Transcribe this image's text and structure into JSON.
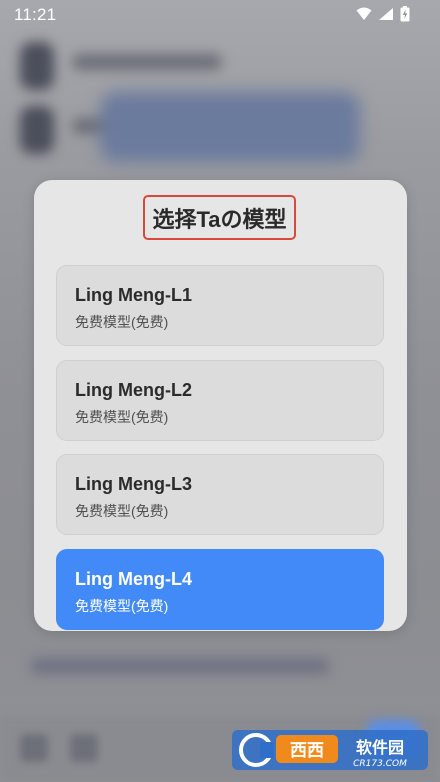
{
  "status_bar": {
    "time": "11:21",
    "icons": [
      "wifi-icon",
      "signal-icon",
      "battery-icon"
    ]
  },
  "dialog": {
    "title": "选择Taの模型",
    "models": [
      {
        "name": "Ling Meng-L1",
        "desc": "免费模型(免费)",
        "selected": false
      },
      {
        "name": "Ling Meng-L2",
        "desc": "免费模型(免费)",
        "selected": false
      },
      {
        "name": "Ling Meng-L3",
        "desc": "免费模型(免费)",
        "selected": false
      },
      {
        "name": "Ling Meng-L4",
        "desc": "免费模型(免费)",
        "selected": true
      }
    ]
  },
  "watermark": {
    "brand": "西西软件园",
    "domain": "CR173.COM"
  },
  "colors": {
    "accent": "#418af7",
    "dialog_bg": "#e6e6e7",
    "title_highlight": "#d8483b"
  }
}
